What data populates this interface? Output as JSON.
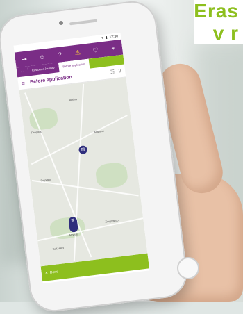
{
  "headline": {
    "line1": "Eras",
    "line2": "v r"
  },
  "status": {
    "time": "12:30"
  },
  "topnav": {
    "icons": [
      "logout-icon",
      "user-icon",
      "help-icon",
      "bell-icon",
      "heart-icon",
      "plus-icon"
    ],
    "glyphs": [
      "⇥",
      "☺",
      "?",
      "⚠",
      "♡",
      "+"
    ]
  },
  "tabs": {
    "back_glyph": "←",
    "items": [
      {
        "label": "Customer Journey",
        "active": false
      },
      {
        "label": "Before application",
        "active": true
      }
    ]
  },
  "page": {
    "title": "Before application",
    "menu_glyph": "≡",
    "list_glyph": "☷",
    "filter_glyph": "⊽"
  },
  "map": {
    "labels": [
      "Αθήνα",
      "Γλυφάδα",
      "Κηφισιά",
      "Πειραιάς",
      "Ζωγράφου",
      "Καλλιθέα"
    ],
    "pins": [
      {
        "glyph": "▤"
      },
      {
        "glyph": "▤"
      }
    ],
    "cluster_label": "Athens"
  },
  "bottombar": {
    "close_glyph": "✕",
    "label": "Done"
  },
  "colors": {
    "brand_purple": "#7a2d86",
    "brand_green": "#8dbf1e",
    "pin": "#2f2e7d"
  }
}
